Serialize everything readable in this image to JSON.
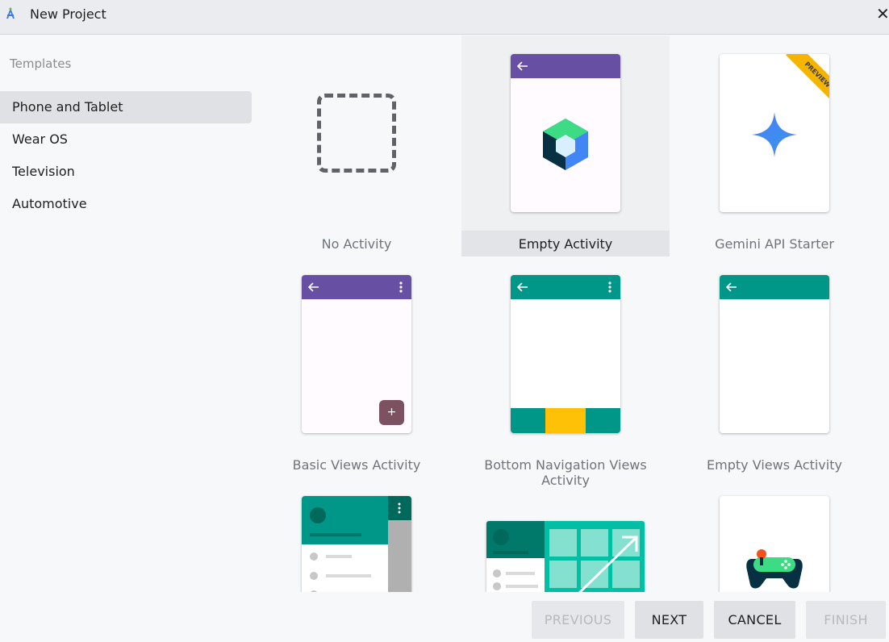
{
  "window": {
    "title": "New Project",
    "app_icon": "android-studio-icon",
    "close_icon": "close-icon"
  },
  "sidebar": {
    "header": "Templates",
    "items": [
      {
        "label": "Phone and Tablet",
        "selected": true
      },
      {
        "label": "Wear OS",
        "selected": false
      },
      {
        "label": "Television",
        "selected": false
      },
      {
        "label": "Automotive",
        "selected": false
      }
    ]
  },
  "templates": [
    {
      "label": "No Activity"
    },
    {
      "label": "Empty Activity",
      "selected": true
    },
    {
      "label": "Gemini API Starter",
      "badge": "PREVIEW"
    },
    {
      "label": "Basic Views Activity",
      "fab_label": "+"
    },
    {
      "label": "Bottom Navigation Views Activity"
    },
    {
      "label": "Empty Views Activity"
    },
    {
      "label": ""
    },
    {
      "label": ""
    },
    {
      "label": ""
    }
  ],
  "buttons": {
    "previous": "PREVIOUS",
    "next": "NEXT",
    "cancel": "CANCEL",
    "finish": "FINISH"
  },
  "colors": {
    "accent_purple": "#6750a4",
    "accent_teal": "#009688",
    "nav_yellow": "#ffc107",
    "badge_yellow": "#f4b400"
  }
}
